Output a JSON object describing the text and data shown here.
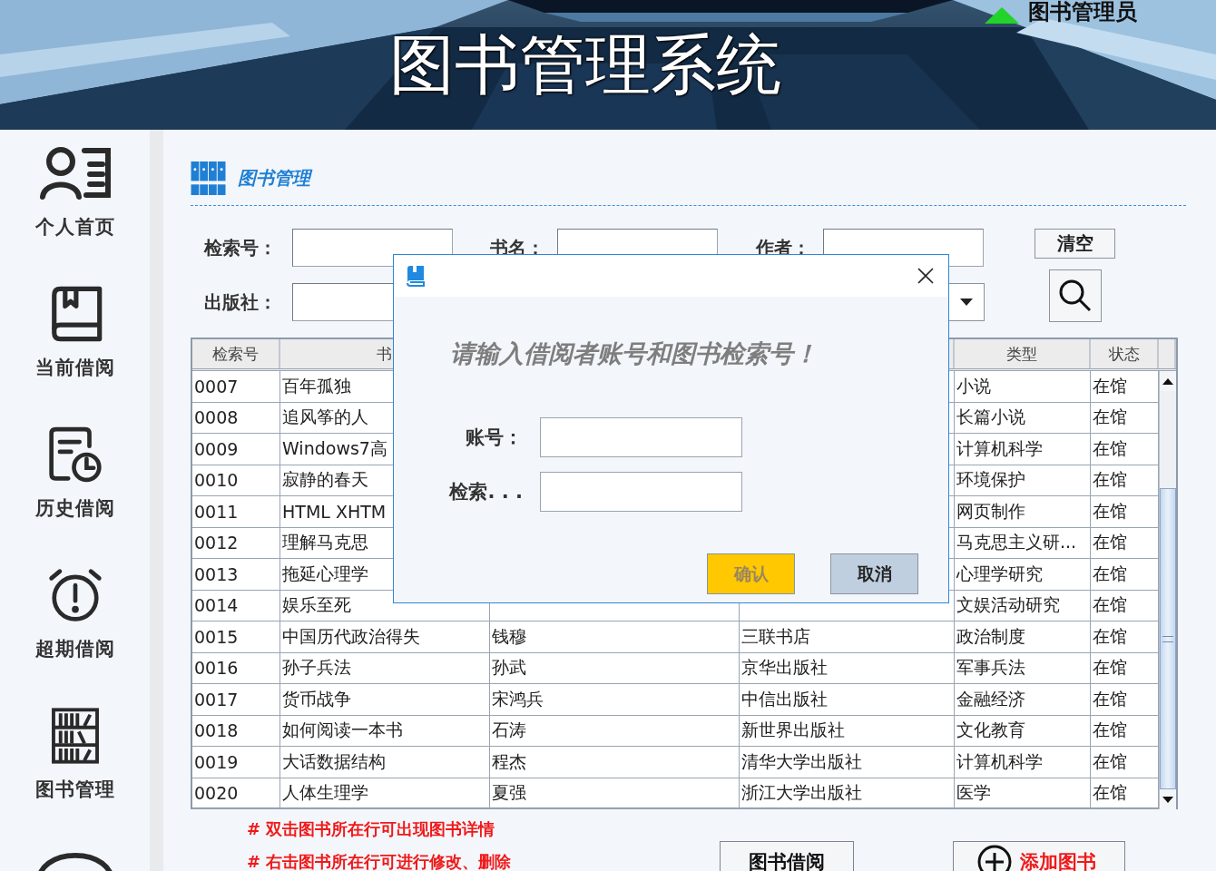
{
  "header": {
    "title": "图书管理系统",
    "user_label": "图书管理员"
  },
  "sidebar": {
    "items": [
      {
        "label": "个人首页",
        "kind": "profile"
      },
      {
        "label": "当前借阅",
        "kind": "current"
      },
      {
        "label": "历史借阅",
        "kind": "history"
      },
      {
        "label": "超期借阅",
        "kind": "overdue"
      },
      {
        "label": "图书管理",
        "kind": "books"
      },
      {
        "kind": "chat"
      }
    ]
  },
  "section": {
    "title": "图书管理"
  },
  "search_form": {
    "fields": [
      {
        "label": "检索号："
      },
      {
        "label": "书名："
      },
      {
        "label": "作者："
      },
      {
        "label": "出版社："
      }
    ],
    "clear_button": "清空"
  },
  "table": {
    "columns": {
      "id": "检索号",
      "title": "书",
      "type": "类型",
      "status": "状态"
    },
    "rows": [
      {
        "id": "0007",
        "title": "百年孤独",
        "type": "小说",
        "status": "在馆"
      },
      {
        "id": "0008",
        "title": "追风筝的人",
        "type": "长篇小说",
        "status": "在馆"
      },
      {
        "id": "0009",
        "title": "Windows7高",
        "type": "计算机科学",
        "status": "在馆"
      },
      {
        "id": "0010",
        "title": "寂静的春天",
        "type": "环境保护",
        "status": "在馆"
      },
      {
        "id": "0011",
        "title": "HTML XHTM",
        "type": "网页制作",
        "status": "在馆"
      },
      {
        "id": "0012",
        "title": "理解马克思",
        "type": "马克思主义研...",
        "status": "在馆"
      },
      {
        "id": "0013",
        "title": "拖延心理学",
        "type": "心理学研究",
        "status": "在馆"
      },
      {
        "id": "0014",
        "title": "娱乐至死",
        "type": "文娱活动研究",
        "status": "在馆"
      },
      {
        "id": "0015",
        "title": "中国历代政治得失",
        "author": "钱穆",
        "publisher": "三联书店",
        "type": "政治制度",
        "status": "在馆"
      },
      {
        "id": "0016",
        "title": "孙子兵法",
        "author": "孙武",
        "publisher": "京华出版社",
        "type": "军事兵法",
        "status": "在馆"
      },
      {
        "id": "0017",
        "title": "货币战争",
        "author": "宋鸿兵",
        "publisher": "中信出版社",
        "type": "金融经济",
        "status": "在馆"
      },
      {
        "id": "0018",
        "title": "如何阅读一本书",
        "author": "石涛",
        "publisher": "新世界出版社",
        "type": "文化教育",
        "status": "在馆"
      },
      {
        "id": "0019",
        "title": "大话数据结构",
        "author": "程杰",
        "publisher": "清华大学出版社",
        "type": "计算机科学",
        "status": "在馆"
      },
      {
        "id": "0020",
        "title": "人体生理学",
        "author": "夏强",
        "publisher": "浙江大学出版社",
        "type": "医学",
        "status": "在馆"
      }
    ]
  },
  "notes": [
    "# 双击图书所在行可出现图书详情",
    "# 右击图书所在行可进行修改、删除"
  ],
  "buttons": [
    {
      "label": "图书借阅",
      "kind": "plain"
    },
    {
      "label": "添加图书",
      "kind": "add"
    }
  ],
  "dialog": {
    "message": "请输入借阅者账号和图书检索号！",
    "fields": [
      {
        "label": "账号："
      },
      {
        "label": "检索. . ."
      }
    ],
    "buttons": [
      {
        "label": "确认",
        "kind": "confirm"
      },
      {
        "label": "取消",
        "kind": "cancel"
      }
    ]
  }
}
